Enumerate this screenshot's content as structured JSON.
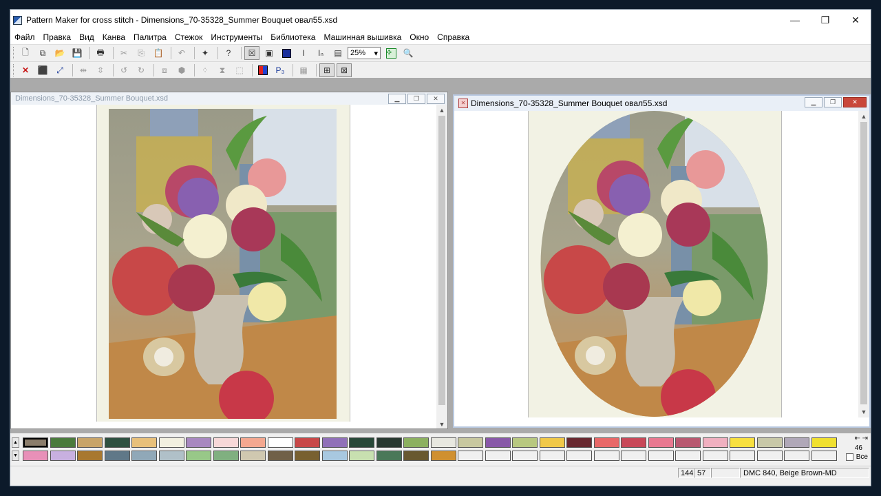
{
  "window": {
    "title": "Pattern Maker for cross stitch - Dimensions_70-35328_Summer Bouquet овал55.xsd",
    "minimize_glyph": "—",
    "restore_glyph": "❐",
    "close_glyph": "✕"
  },
  "menu": [
    "Файл",
    "Правка",
    "Вид",
    "Канва",
    "Палитра",
    "Стежок",
    "Инструменты",
    "Библиотека",
    "Машинная вышивка",
    "Окно",
    "Справка"
  ],
  "toolbar": {
    "zoom_value": "25%"
  },
  "left_window": {
    "title": "Dimensions_70-35328_Summer Bouquet.xsd"
  },
  "right_window": {
    "title": "Dimensions_70-35328_Summer Bouquet овал55.xsd"
  },
  "palette": {
    "count": "46",
    "all_label": "Все",
    "row1": [
      "#8b7d6b",
      "#4a7a3c",
      "#c8a468",
      "#2e5040",
      "#e8c07a",
      "#f2f0e0",
      "#a888c0",
      "#f7d8d8",
      "#f4a890",
      "#ffffff",
      "#c84848",
      "#9070b8",
      "#284838",
      "#283830",
      "#8cb060",
      "#e8e8e0",
      "#c8c8a0",
      "#8858a8",
      "#b8c880",
      "#f0c848",
      "#682830",
      "#e86868",
      "#c84858",
      "#e87890",
      "#b85870",
      "#f0b0c0",
      "#f8e040",
      "#c8c8a8",
      "#b0a8b8",
      "#f0e030"
    ],
    "row2": [
      "#e890b8",
      "#c8b0e0",
      "#a87830",
      "#607888",
      "#90a8b8",
      "#b0c0c8",
      "#98c888",
      "#80b080",
      "#d0c8b0",
      "#706048",
      "#786030",
      "#a8c8e0",
      "#c8e0b0",
      "#4a7858",
      "#685830",
      "#d09030",
      "#f0f0f0",
      "#f0f0f0",
      "#f0f0f0",
      "#f0f0f0",
      "#f0f0f0",
      "#f0f0f0",
      "#f0f0f0",
      "#f0f0f0",
      "#f0f0f0",
      "#f0f0f0",
      "#f0f0f0",
      "#f0f0f0",
      "#f0f0f0",
      "#f0f0f0"
    ]
  },
  "status": {
    "x": "144",
    "y": "57",
    "color_info": "DMC  840, Beige Brown-MD"
  }
}
